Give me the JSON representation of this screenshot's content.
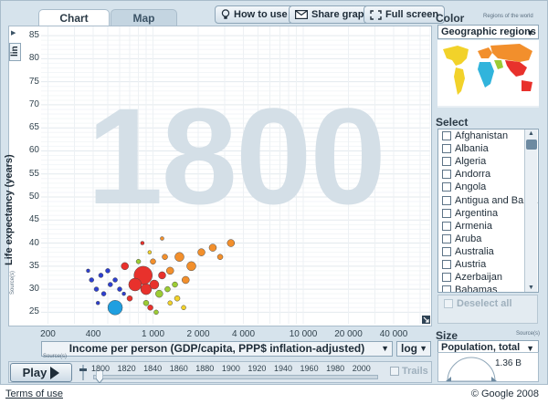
{
  "tabs": [
    {
      "label": "Chart",
      "active": true
    },
    {
      "label": "Map",
      "active": false
    }
  ],
  "toolbar": {
    "how_to_use": "How to use",
    "share_graph": "Share graph",
    "full_screen": "Full screen"
  },
  "plot": {
    "year_background": "1800",
    "y_scale": "lin",
    "x_scale": "log",
    "y_axis_title": "Life expectancy (years)",
    "x_axis_title": "Income per person (GDP/capita, PPP$ inflation-adjusted)",
    "source_label": "Source(s)",
    "y_ticks": [
      "85",
      "80",
      "75",
      "70",
      "65",
      "60",
      "55",
      "50",
      "45",
      "40",
      "35",
      "30",
      "25"
    ],
    "x_ticks": [
      "200",
      "400",
      "1 000",
      "2 000",
      "4 000",
      "10 000",
      "20 000",
      "40 000"
    ]
  },
  "chart_data": {
    "type": "scatter",
    "ylabel": "Life expectancy (years)",
    "xlabel": "Income per person (GDP/capita, PPP$ inflation-adjusted)",
    "xscale": "log",
    "xlim": [
      180,
      70000
    ],
    "ylim": [
      22.5,
      87
    ],
    "grid": true,
    "points": [
      {
        "x": 560,
        "y": 26,
        "size": 8,
        "color": "#1f9fe0"
      },
      {
        "x": 860,
        "y": 33,
        "size": 10,
        "color": "#e8312c"
      },
      {
        "x": 760,
        "y": 31,
        "size": 7,
        "color": "#e8312c"
      },
      {
        "x": 900,
        "y": 30,
        "size": 6,
        "color": "#e8312c"
      },
      {
        "x": 1020,
        "y": 31,
        "size": 5,
        "color": "#e8312c"
      },
      {
        "x": 650,
        "y": 35,
        "size": 4,
        "color": "#e8312c"
      },
      {
        "x": 1150,
        "y": 33,
        "size": 4,
        "color": "#e8312c"
      },
      {
        "x": 700,
        "y": 28,
        "size": 3,
        "color": "#e8312c"
      },
      {
        "x": 450,
        "y": 33,
        "size": 2.5,
        "color": "#2d3fd0"
      },
      {
        "x": 520,
        "y": 31,
        "size": 2.5,
        "color": "#2d3fd0"
      },
      {
        "x": 390,
        "y": 32,
        "size": 2.5,
        "color": "#2d3fd0"
      },
      {
        "x": 470,
        "y": 29,
        "size": 2.5,
        "color": "#2d3fd0"
      },
      {
        "x": 600,
        "y": 30,
        "size": 2.5,
        "color": "#2d3fd0"
      },
      {
        "x": 420,
        "y": 30,
        "size": 2.5,
        "color": "#2d3fd0"
      },
      {
        "x": 500,
        "y": 34,
        "size": 2.5,
        "color": "#2d3fd0"
      },
      {
        "x": 560,
        "y": 32,
        "size": 2.5,
        "color": "#2d3fd0"
      },
      {
        "x": 430,
        "y": 27,
        "size": 2,
        "color": "#2d3fd0"
      },
      {
        "x": 640,
        "y": 29,
        "size": 2,
        "color": "#2d3fd0"
      },
      {
        "x": 370,
        "y": 34,
        "size": 2,
        "color": "#2d3fd0"
      },
      {
        "x": 1500,
        "y": 37,
        "size": 5,
        "color": "#f28f2c"
      },
      {
        "x": 1800,
        "y": 35,
        "size": 5,
        "color": "#f28f2c"
      },
      {
        "x": 2100,
        "y": 38,
        "size": 4,
        "color": "#f28f2c"
      },
      {
        "x": 2500,
        "y": 39,
        "size": 4,
        "color": "#f28f2c"
      },
      {
        "x": 3300,
        "y": 40,
        "size": 4,
        "color": "#f28f2c"
      },
      {
        "x": 1300,
        "y": 34,
        "size": 4,
        "color": "#f28f2c"
      },
      {
        "x": 1650,
        "y": 32,
        "size": 4,
        "color": "#f28f2c"
      },
      {
        "x": 2800,
        "y": 37,
        "size": 3,
        "color": "#f28f2c"
      },
      {
        "x": 1200,
        "y": 37,
        "size": 3,
        "color": "#f28f2c"
      },
      {
        "x": 1000,
        "y": 36,
        "size": 3,
        "color": "#f28f2c"
      },
      {
        "x": 1100,
        "y": 29,
        "size": 4,
        "color": "#9ccc34"
      },
      {
        "x": 1250,
        "y": 30,
        "size": 3,
        "color": "#9ccc34"
      },
      {
        "x": 900,
        "y": 27,
        "size": 3,
        "color": "#9ccc34"
      },
      {
        "x": 1400,
        "y": 31,
        "size": 3,
        "color": "#9ccc34"
      },
      {
        "x": 1050,
        "y": 25,
        "size": 2.5,
        "color": "#9ccc34"
      },
      {
        "x": 800,
        "y": 36,
        "size": 2.5,
        "color": "#9ccc34"
      },
      {
        "x": 1450,
        "y": 28,
        "size": 3,
        "color": "#f2d22a"
      },
      {
        "x": 1600,
        "y": 26,
        "size": 2.5,
        "color": "#f2d22a"
      },
      {
        "x": 1300,
        "y": 27,
        "size": 2.5,
        "color": "#f2d22a"
      },
      {
        "x": 950,
        "y": 38,
        "size": 2,
        "color": "#f2d22a"
      },
      {
        "x": 850,
        "y": 40,
        "size": 2,
        "color": "#e8312c"
      },
      {
        "x": 1150,
        "y": 41,
        "size": 2,
        "color": "#f28f2c"
      },
      {
        "x": 960,
        "y": 26,
        "size": 3,
        "color": "#e8312c"
      }
    ]
  },
  "color_panel": {
    "title": "Color",
    "legend_caption": "Regions of the world",
    "selected": "Geographic regions",
    "region_colors": [
      "#31b4dc",
      "#9ccc34",
      "#f2d22a",
      "#f28f2c",
      "#e8312c",
      "#2d3fd0"
    ]
  },
  "select_panel": {
    "title": "Select",
    "countries": [
      "Afghanistan",
      "Albania",
      "Algeria",
      "Andorra",
      "Angola",
      "Antigua and Barb...",
      "Argentina",
      "Armenia",
      "Aruba",
      "Australia",
      "Austria",
      "Azerbaijan",
      "Bahamas"
    ],
    "deselect_all": "Deselect all"
  },
  "size_panel": {
    "title": "Size",
    "source_label": "Source(s)",
    "selected": "Population, total",
    "gauge_value": "1.36 B"
  },
  "player": {
    "play_label": "Play",
    "years": [
      "1800",
      "1820",
      "1840",
      "1860",
      "1880",
      "1900",
      "1920",
      "1940",
      "1960",
      "1980",
      "2000"
    ],
    "current_year": "1800",
    "trails_label": "Trails"
  },
  "footer": {
    "terms": "Terms of use",
    "copyright": "© Google 2008"
  }
}
